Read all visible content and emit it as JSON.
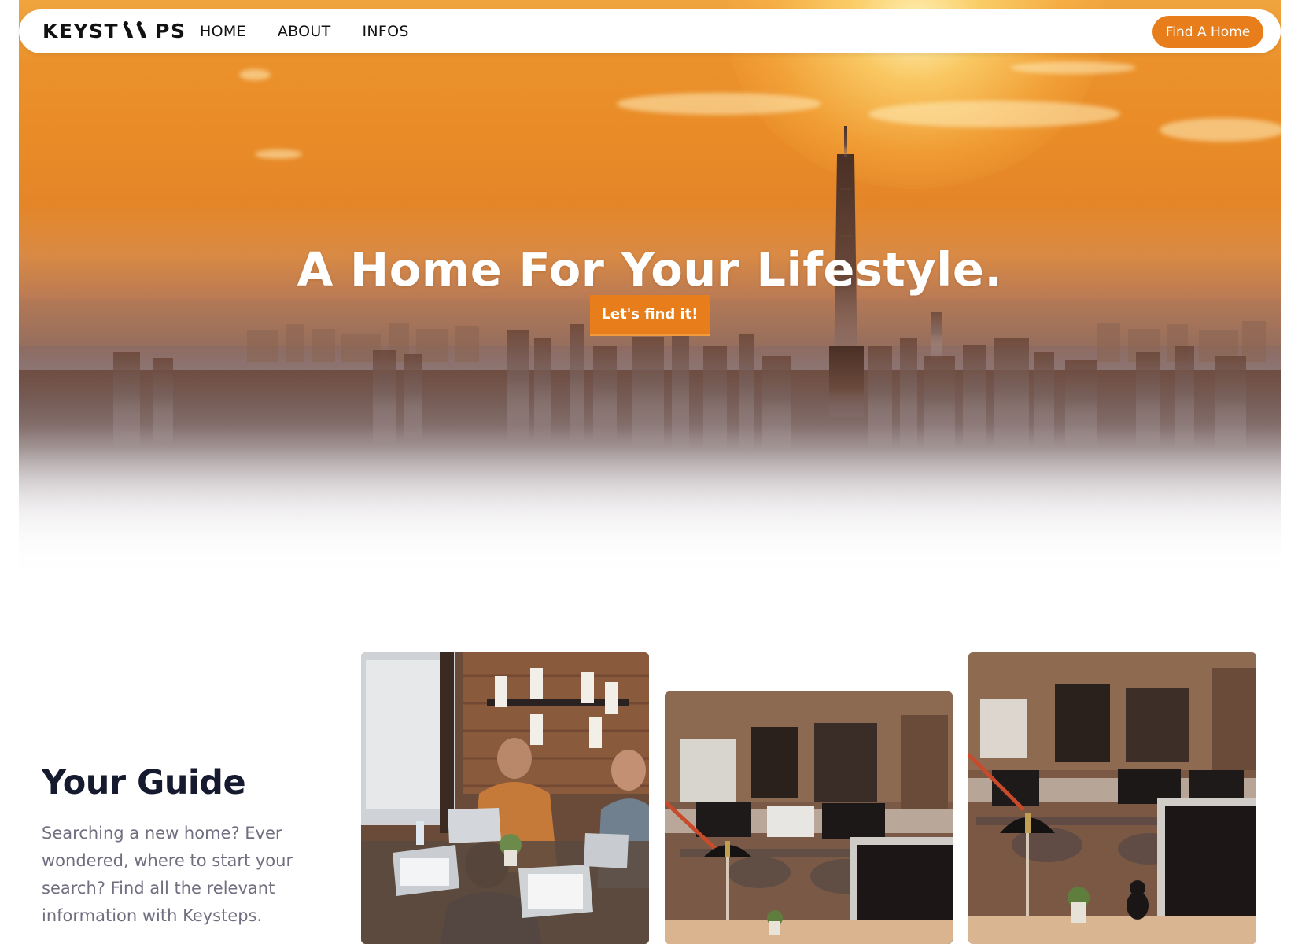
{
  "navbar": {
    "logo_text_left": "KEYST",
    "logo_text_right": "PS",
    "links": [
      {
        "label": "HOME"
      },
      {
        "label": "ABOUT"
      },
      {
        "label": "INFOS"
      }
    ],
    "cta_label": "Find A Home"
  },
  "hero": {
    "title": "A Home For Your Lifestyle.",
    "cta_label": "Let's find it!"
  },
  "guide": {
    "title": "Your Guide",
    "text": "Searching a new home? Ever wondered, where to start your search? Find all the relevant information with Keysteps."
  },
  "colors": {
    "accent": "#e77e1b",
    "heading": "#161a2e",
    "body_text": "#6f6f80"
  },
  "icons": {
    "logo_mark": "footprints-icon"
  }
}
